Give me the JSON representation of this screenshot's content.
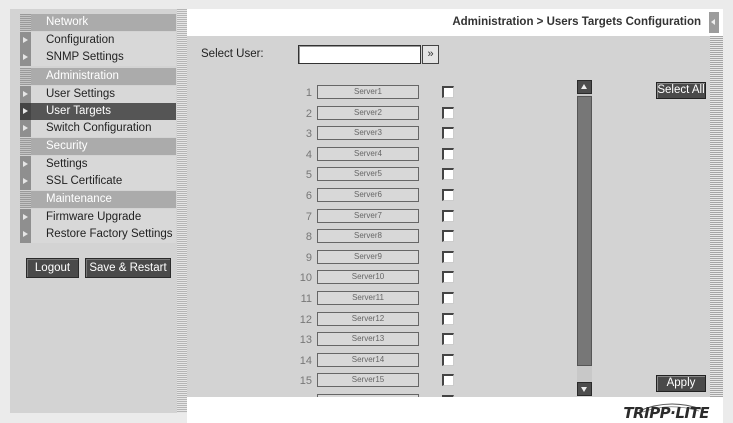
{
  "sidebar": {
    "sections": [
      {
        "title": "Network",
        "items": [
          "Configuration",
          "SNMP Settings"
        ]
      },
      {
        "title": "Administration",
        "items": [
          "User Settings",
          "User Targets",
          "Switch Configuration"
        ]
      },
      {
        "title": "Security",
        "items": [
          "Settings",
          "SSL Certificate"
        ]
      },
      {
        "title": "Maintenance",
        "items": [
          "Firmware Upgrade",
          "Restore Factory Settings"
        ]
      }
    ],
    "active_item": "User Targets",
    "logout_label": "Logout",
    "save_restart_label": "Save & Restart"
  },
  "header": {
    "breadcrumb": "Administration > Users Targets Configuration"
  },
  "select_user": {
    "label": "Select User:",
    "value": "",
    "go_label": "»"
  },
  "servers": [
    {
      "num": "1",
      "name": "Server1",
      "checked": false
    },
    {
      "num": "2",
      "name": "Server2",
      "checked": false
    },
    {
      "num": "3",
      "name": "Server3",
      "checked": false
    },
    {
      "num": "4",
      "name": "Server4",
      "checked": false
    },
    {
      "num": "5",
      "name": "Server5",
      "checked": false
    },
    {
      "num": "6",
      "name": "Server6",
      "checked": false
    },
    {
      "num": "7",
      "name": "Server7",
      "checked": false
    },
    {
      "num": "8",
      "name": "Server8",
      "checked": false
    },
    {
      "num": "9",
      "name": "Server9",
      "checked": false
    },
    {
      "num": "10",
      "name": "Server10",
      "checked": false
    },
    {
      "num": "11",
      "name": "Server11",
      "checked": false
    },
    {
      "num": "12",
      "name": "Server12",
      "checked": false
    },
    {
      "num": "13",
      "name": "Server13",
      "checked": false
    },
    {
      "num": "14",
      "name": "Server14",
      "checked": false
    },
    {
      "num": "15",
      "name": "Server15",
      "checked": false
    },
    {
      "num": "",
      "name": "",
      "checked": false
    }
  ],
  "actions": {
    "select_all_label": "Select All",
    "apply_label": "Apply"
  },
  "branding": {
    "logo_text": "TRIPP·LITE"
  }
}
